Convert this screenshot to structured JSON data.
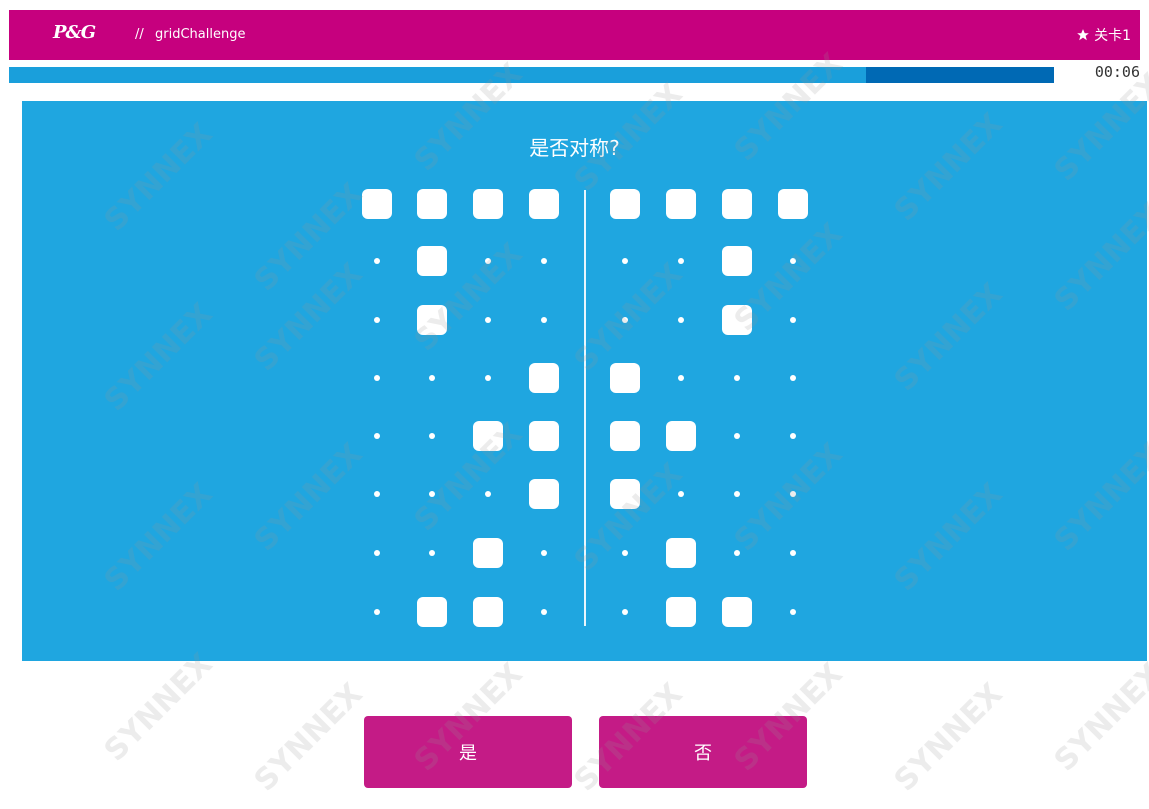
{
  "header": {
    "brand": "P&G",
    "separator": "//",
    "title": "gridChallenge",
    "level_label": "关卡1",
    "star_icon": "star-icon"
  },
  "progress": {
    "fraction": 0.82,
    "timer": "00:06"
  },
  "question": "是否对称?",
  "grid": {
    "rows": [
      [
        1,
        1,
        1,
        1,
        1,
        1,
        1,
        1
      ],
      [
        0,
        1,
        0,
        0,
        0,
        0,
        1,
        0
      ],
      [
        0,
        1,
        0,
        0,
        0,
        0,
        1,
        0
      ],
      [
        0,
        0,
        0,
        1,
        1,
        0,
        0,
        0
      ],
      [
        0,
        0,
        1,
        1,
        1,
        1,
        0,
        0
      ],
      [
        0,
        0,
        0,
        1,
        1,
        0,
        0,
        0
      ],
      [
        0,
        0,
        1,
        0,
        0,
        1,
        0,
        0
      ],
      [
        0,
        1,
        1,
        0,
        0,
        1,
        1,
        0
      ]
    ]
  },
  "buttons": {
    "yes": "是",
    "no": "否"
  },
  "colors": {
    "header": "#c6007e",
    "panel": "#1fa6e0",
    "button": "#c41b86",
    "progress_fill": "#1a9fdb",
    "progress_track": "#0069b4"
  },
  "watermark": "SYNNEX"
}
